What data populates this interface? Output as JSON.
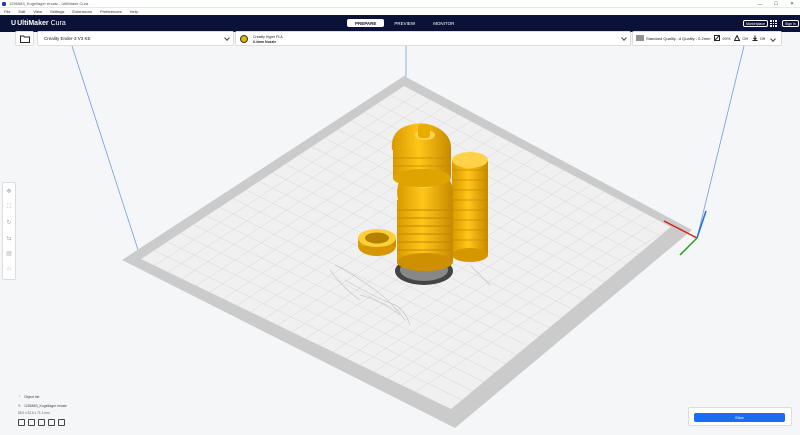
{
  "window": {
    "title": "1256583_Kugellager ersatz - UltiMaker Cura",
    "min": "—",
    "max": "☐",
    "close": "✕"
  },
  "menu": [
    "File",
    "Edit",
    "View",
    "Settings",
    "Extensions",
    "Preferences",
    "Help"
  ],
  "header": {
    "logo_mark": "U",
    "logo_word": "UltiMaker",
    "logo_word2": "Cura",
    "stages": [
      "PREPARE",
      "PREVIEW",
      "MONITOR"
    ],
    "active_stage": "PREPARE",
    "marketplace": "Marketplace",
    "signin": "Sign in"
  },
  "printer": {
    "name": "Creality Ender-3 V3 KE"
  },
  "material": {
    "name": "Creality Hyper PLA",
    "nozzle": "0.4mm Nozzle"
  },
  "print_settings": {
    "profile": "Standard Quality - 0.2mm",
    "profile_display": "Standard Quality...d Quality - 0.2mm",
    "infill": "20%",
    "support": "Off",
    "adhesion": "Off"
  },
  "objects": {
    "toggle_label": "Object list",
    "item_name": "1256583_Kugellager ersatz",
    "dimensions": "58.9 x 52.6 x 71.2 mm"
  },
  "slice": {
    "label": "Slice"
  },
  "colors": {
    "header_bg": "#0b1237",
    "accent": "#196ef0",
    "model": "#f6b800",
    "plate": "#ededed",
    "grid": "#d8d8d8"
  }
}
